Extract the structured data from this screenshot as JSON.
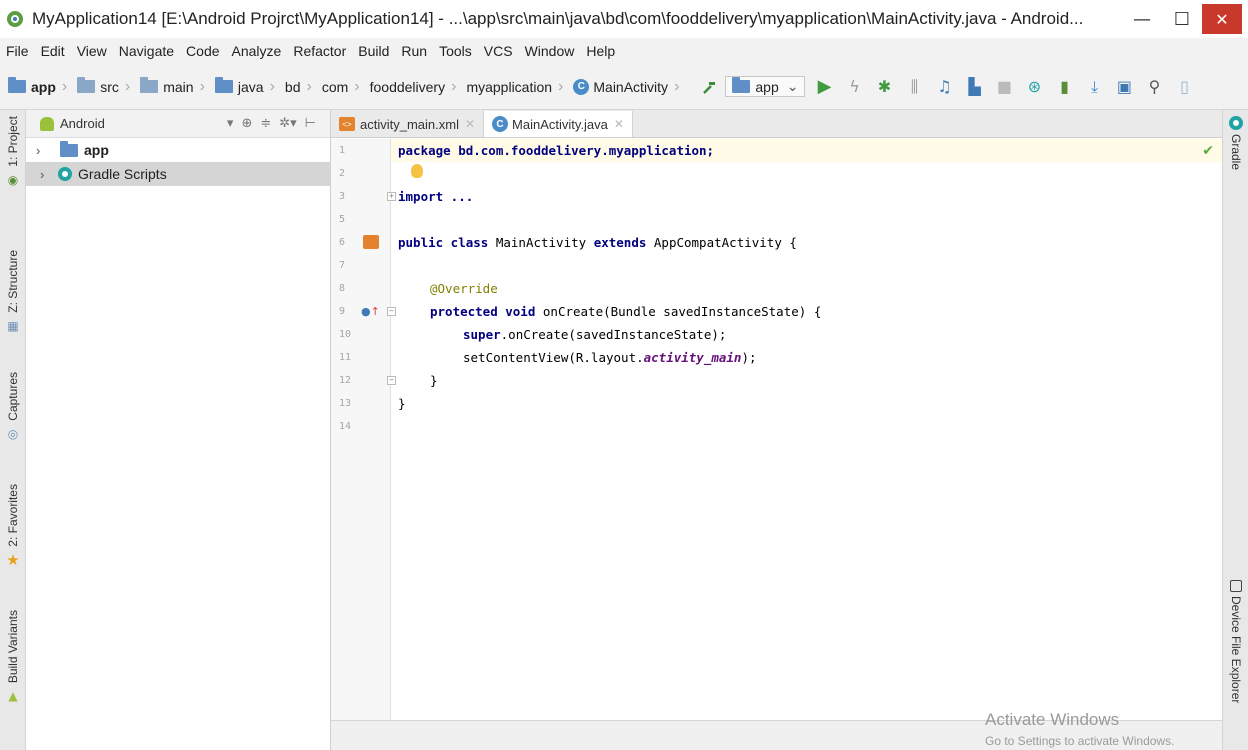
{
  "window": {
    "title": "MyApplication14 [E:\\Android Projrct\\MyApplication14] - ...\\app\\src\\main\\java\\bd\\com\\fooddelivery\\myapplication\\MainActivity.java - Android...",
    "minimize": "—",
    "maximize": "☐",
    "close": "✕"
  },
  "menu": [
    "File",
    "Edit",
    "View",
    "Navigate",
    "Code",
    "Analyze",
    "Refactor",
    "Build",
    "Run",
    "Tools",
    "VCS",
    "Window",
    "Help"
  ],
  "breadcrumbs": [
    "app",
    "src",
    "main",
    "java",
    "bd",
    "com",
    "fooddelivery",
    "myapplication",
    "MainActivity"
  ],
  "run_config": "app",
  "left_tabs": [
    "1: Project",
    "Z: Structure",
    "Captures",
    "2: Favorites",
    "Build Variants"
  ],
  "right_tabs": [
    "Gradle",
    "Device File Explorer"
  ],
  "project_panel": {
    "view_mode": "Android",
    "items": [
      {
        "label": "app",
        "selected": false
      },
      {
        "label": "Gradle Scripts",
        "selected": true
      }
    ]
  },
  "editor": {
    "tabs": [
      {
        "label": "activity_main.xml",
        "active": false,
        "icon": "xml-file-icon"
      },
      {
        "label": "MainActivity.java",
        "active": true,
        "icon": "java-class-icon"
      }
    ],
    "line_numbers": [
      "1",
      "2",
      "3",
      "5",
      "6",
      "7",
      "8",
      "9",
      "10",
      "11",
      "12",
      "13",
      "14"
    ],
    "lines": {
      "l1": "package bd.com.fooddelivery.myapplication;",
      "l3": "import ...",
      "l6a": "public class ",
      "l6b": "MainActivity ",
      "l6c": "extends ",
      "l6d": "AppCompatActivity {",
      "l8": "@Override",
      "l9a": "protected void ",
      "l9b": "onCreate(Bundle savedInstanceState) {",
      "l10a": "super",
      "l10b": ".onCreate(savedInstanceState);",
      "l11a": "setContentView(R.layout.",
      "l11b": "activity_main",
      "l11c": ");",
      "l12": "}",
      "l13": "}"
    }
  },
  "watermark": {
    "title": "Activate Windows",
    "subtitle": "Go to Settings to activate Windows."
  }
}
